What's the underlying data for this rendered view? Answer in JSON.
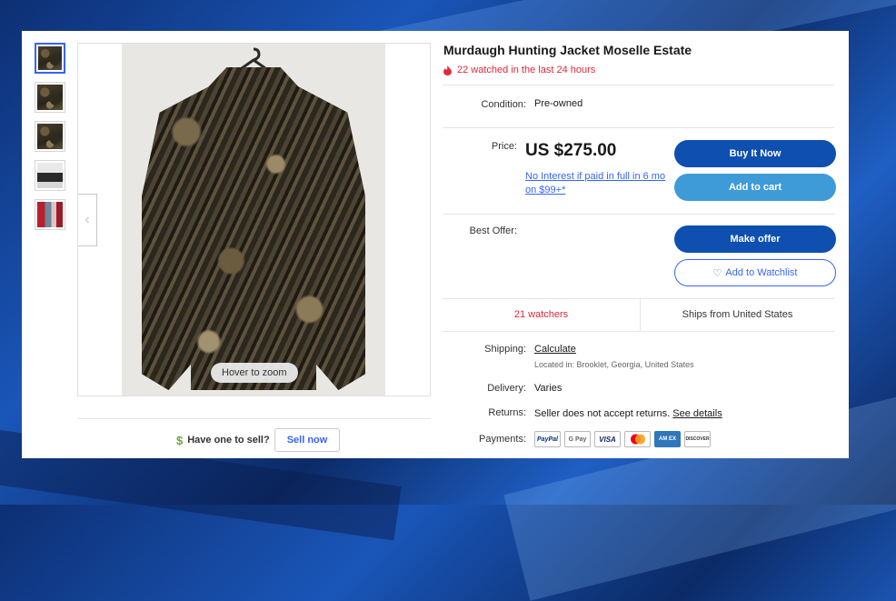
{
  "listing": {
    "title": "Murdaugh Hunting Jacket Moselle Estate",
    "watched_recent": "22 watched in the last 24 hours",
    "condition_label": "Condition:",
    "condition_value": "Pre-owned",
    "price_label": "Price:",
    "price": "US $275.00",
    "financing": "No Interest if paid in full in 6 mo on $99+*",
    "best_offer_label": "Best Offer:",
    "watchers": "21 watchers",
    "ships_from": "Ships from United States",
    "shipping_label": "Shipping:",
    "shipping_value": "Calculate",
    "located_in": "Located in: Brooklet, Georgia, United States",
    "delivery_label": "Delivery:",
    "delivery_value": "Varies",
    "returns_label": "Returns:",
    "returns_value": "Seller does not accept returns.",
    "returns_link": "See details",
    "payments_label": "Payments:"
  },
  "buttons": {
    "buy_now": "Buy It Now",
    "add_to_cart": "Add to cart",
    "make_offer": "Make offer",
    "add_to_watchlist": "Add to Watchlist"
  },
  "gallery": {
    "zoom_hint": "Hover to zoom",
    "thumbnails": [
      "camo-jacket",
      "camo-jacket",
      "camo-jacket",
      "gray-photo",
      "red-photo"
    ],
    "active_thumbnail": 0
  },
  "sell": {
    "prompt": "Have one to sell?",
    "button": "Sell now"
  },
  "payments": [
    {
      "name": "paypal-logo",
      "text": "PayPal",
      "color": "#003087"
    },
    {
      "name": "google-pay-logo",
      "text": "G Pay",
      "color": "#5f6368"
    },
    {
      "name": "visa-logo",
      "text": "VISA",
      "color": "#1a1f71"
    },
    {
      "name": "mastercard-logo",
      "text": "",
      "color": "#eb001b"
    },
    {
      "name": "amex-logo",
      "text": "AM EX",
      "color": "#2e77bc"
    },
    {
      "name": "discover-logo",
      "text": "DISCOVER",
      "color": "#f68121"
    }
  ],
  "colors": {
    "accent_blue": "#3665f3",
    "buy_now": "#0e4fb0",
    "add_to_cart": "#3f9bd8",
    "alert_red": "#e0293a"
  }
}
